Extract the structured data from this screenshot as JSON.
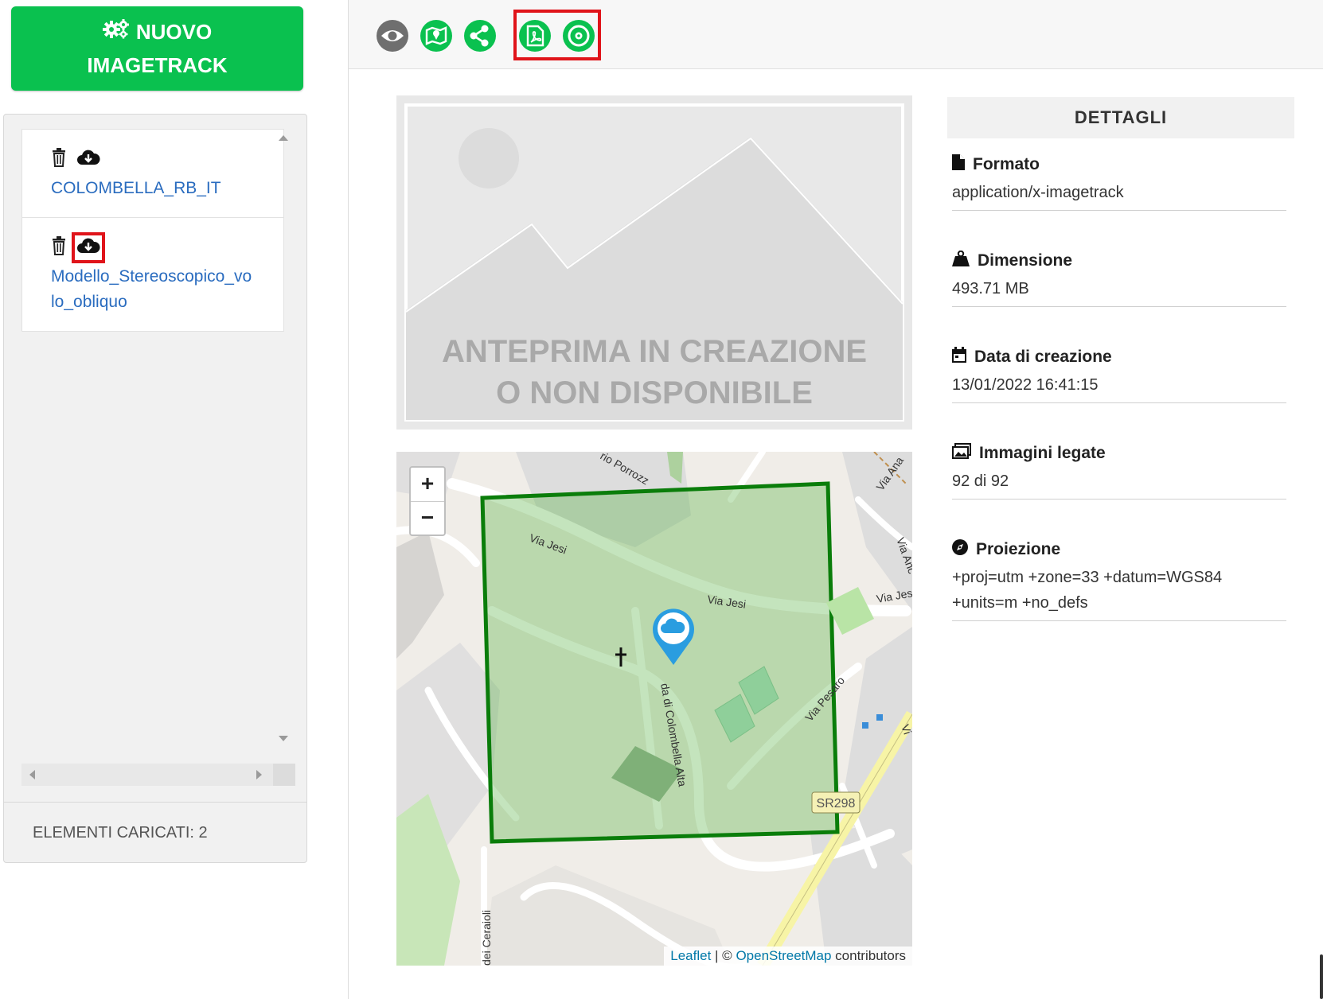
{
  "new_button": {
    "line1": "NUOVO",
    "line2": "IMAGETRACK",
    "icon": "gears-icon"
  },
  "sidebar": {
    "items": [
      {
        "label": "COLOMBELLA_RB_IT",
        "delete_icon": "trash-icon",
        "download_icon": "cloud-download-icon"
      },
      {
        "label": "Modello_Stereoscopico_volo_obliquo",
        "delete_icon": "trash-icon",
        "download_icon": "cloud-download-icon"
      }
    ],
    "footer": "ELEMENTI CARICATI: 2"
  },
  "toolbar": {
    "icons": [
      "eye-icon",
      "map-icon",
      "share-icon",
      "pdf-icon",
      "disc-icon"
    ],
    "color": "#0ac14f"
  },
  "preview": {
    "line1": "ANTEPRIMA IN CREAZIONE",
    "line2": "O NON DISPONIBILE"
  },
  "map": {
    "zoom_in": "+",
    "zoom_out": "−",
    "labels": [
      "Via Jesi",
      "Via Jesi",
      "Via Jes",
      "Via Pesaro",
      "da di Colombella Alta",
      "SR298",
      "Via Ana",
      "Via Anc",
      "Vi",
      "dei Ceraioli",
      "rio Porrozz"
    ],
    "attribution": {
      "leaflet": "Leaflet",
      "sep": " | © ",
      "osm": "OpenStreetMap",
      "suffix": " contributors"
    },
    "footprint_color": "#0a7d0a"
  },
  "details": {
    "heading": "DETTAGLI",
    "fields": [
      {
        "label": "Formato",
        "value": "application/x-imagetrack",
        "icon": "file-icon"
      },
      {
        "label": "Dimensione",
        "value": "493.71 MB",
        "icon": "weight-icon"
      },
      {
        "label": "Data di creazione",
        "value": "13/01/2022 16:41:15",
        "icon": "calendar-icon"
      },
      {
        "label": "Immagini legate",
        "value": "92 di 92",
        "icon": "images-icon"
      },
      {
        "label": "Proiezione",
        "value": "+proj=utm +zone=33 +datum=WGS84 +units=m +no_defs",
        "icon": "compass-icon"
      }
    ]
  }
}
